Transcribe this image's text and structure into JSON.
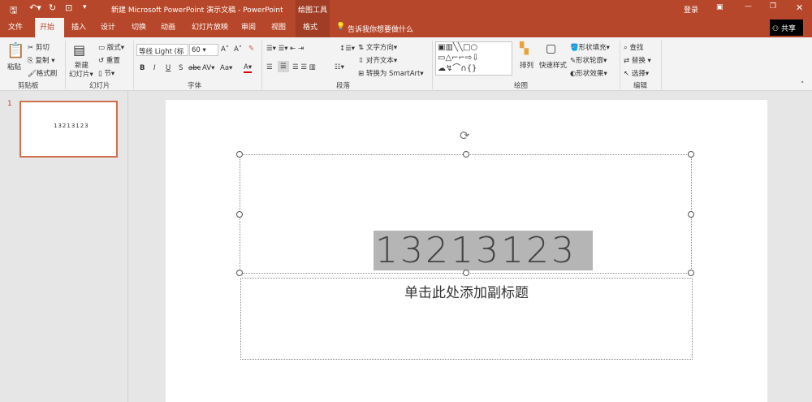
{
  "titlebar": {
    "title": "新建 Microsoft PowerPoint 演示文稿 - PowerPoint",
    "context_tab_group": "绘图工具",
    "login": "登录"
  },
  "tabs": [
    "文件",
    "开始",
    "插入",
    "设计",
    "切换",
    "动画",
    "幻灯片放映",
    "审阅",
    "视图",
    "格式"
  ],
  "tell_me": "告诉我你想要做什么",
  "share": "共享",
  "ribbon": {
    "clipboard": {
      "paste": "粘贴",
      "cut": "剪切",
      "copy": "复制",
      "format_painter": "格式刷",
      "label": "剪贴板"
    },
    "slides": {
      "new_slide_1": "新建",
      "new_slide_2": "幻灯片",
      "layout": "版式",
      "reset": "重置",
      "section": "节",
      "label": "幻灯片"
    },
    "font": {
      "font_name": "等线 Light (标",
      "font_size": "60",
      "label": "字体",
      "bold": "B",
      "italic": "I",
      "underline": "U",
      "shadow": "S",
      "strike": "abc",
      "spacing": "AV",
      "case": "Aa",
      "color": "A"
    },
    "paragraph": {
      "text_direction": "文字方向",
      "align_text": "对齐文本",
      "smartart": "转换为 SmartArt",
      "label": "段落"
    },
    "drawing": {
      "arrange": "排列",
      "quick_styles": "快速样式",
      "fill": "形状填充",
      "outline": "形状轮廓",
      "effects": "形状效果",
      "label": "绘图"
    },
    "editing": {
      "find": "查找",
      "replace": "替换",
      "select": "选择",
      "label": "编辑"
    }
  },
  "slides_pane": {
    "number": "1",
    "thumb_text": "13213123"
  },
  "slide": {
    "title": "13213123",
    "subtitle_placeholder": "单击此处添加副标题"
  },
  "colors": {
    "accent": "#b7472a",
    "thumb_border": "#d0704f",
    "selection": "#b5b5b5"
  }
}
